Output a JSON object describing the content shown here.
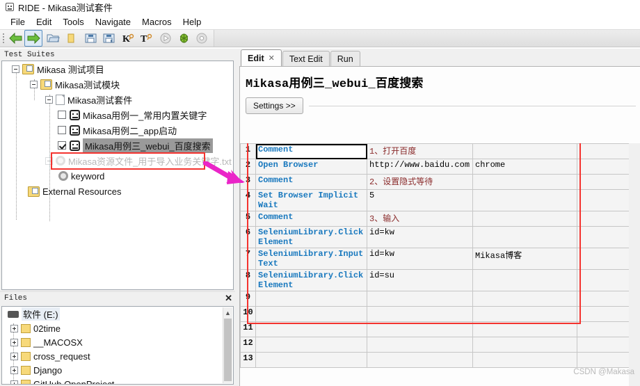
{
  "window": {
    "title": "RIDE - Mikasa测试套件",
    "icon": "app-icon"
  },
  "menubar": {
    "items": [
      "File",
      "Edit",
      "Tools",
      "Navigate",
      "Macros",
      "Help"
    ]
  },
  "toolbar": {
    "buttons": [
      {
        "name": "back-icon",
        "selected": false
      },
      {
        "name": "forward-icon",
        "selected": true
      },
      {
        "name": "open-folder-icon",
        "selected": false
      },
      {
        "name": "new-folder-icon",
        "selected": false
      },
      {
        "name": "save-icon",
        "selected": false
      },
      {
        "name": "save-all-icon",
        "selected": false
      },
      {
        "name": "search-keyword-icon",
        "selected": false
      },
      {
        "name": "search-test-icon",
        "selected": false
      },
      {
        "name": "run-icon",
        "selected": false
      },
      {
        "name": "debug-icon",
        "selected": false
      },
      {
        "name": "stop-icon",
        "selected": false
      }
    ]
  },
  "test_suites_panel": {
    "caption": "Test Suites",
    "tree": [
      {
        "label": "Mikasa 测试项目",
        "indent": 0,
        "icon": "project-icon",
        "expander": "minus",
        "checkbox": null,
        "state": "normal"
      },
      {
        "label": "Mikasa测试模块",
        "indent": 1,
        "icon": "project-icon",
        "expander": "minus",
        "checkbox": null,
        "state": "normal"
      },
      {
        "label": "Mikasa测试套件",
        "indent": 2,
        "icon": "document-icon",
        "expander": "minus",
        "checkbox": null,
        "state": "normal"
      },
      {
        "label": "Mikasa用例一_常用内置关键字",
        "indent": 3,
        "icon": "testcase-icon",
        "expander": null,
        "checkbox": "off",
        "state": "normal"
      },
      {
        "label": "Mikasa用例二_app启动",
        "indent": 3,
        "icon": "testcase-icon",
        "expander": null,
        "checkbox": "off",
        "state": "normal"
      },
      {
        "label": "Mikasa用例三_webui_百度搜索",
        "indent": 3,
        "icon": "testcase-icon",
        "expander": null,
        "checkbox": "on",
        "state": "selected"
      },
      {
        "label": "Mikasa资源文件_用于导入业务关键字.txt",
        "indent": 2,
        "icon": "gear-icon",
        "expander": "minus",
        "checkbox": null,
        "state": "ghost"
      },
      {
        "label": "keyword",
        "indent": 3,
        "icon": "gear-icon",
        "expander": null,
        "checkbox": null,
        "state": "normal"
      },
      {
        "label": "External Resources",
        "indent": 0,
        "icon": "project-icon",
        "expander": null,
        "checkbox": null,
        "state": "normal"
      }
    ]
  },
  "files_panel": {
    "caption": "Files",
    "close_label": "✕",
    "items": [
      {
        "label": "软件 (E:)",
        "icon": "drive-icon",
        "expander": null,
        "selected": true
      },
      {
        "label": "02time",
        "icon": "folder-icon",
        "expander": "plus",
        "selected": false
      },
      {
        "label": "__MACOSX",
        "icon": "folder-icon",
        "expander": "plus",
        "selected": false
      },
      {
        "label": "cross_request",
        "icon": "folder-icon",
        "expander": "plus",
        "selected": false
      },
      {
        "label": "Django",
        "icon": "folder-icon",
        "expander": "plus",
        "selected": false
      },
      {
        "label": "GitHub OpenProject",
        "icon": "folder-icon",
        "expander": "plus",
        "selected": false
      }
    ]
  },
  "editor": {
    "tabs": [
      {
        "label": "Edit",
        "active": true,
        "closable": true,
        "close_label": "✕"
      },
      {
        "label": "Text Edit",
        "active": false,
        "closable": false,
        "close_label": ""
      },
      {
        "label": "Run",
        "active": false,
        "closable": false,
        "close_label": ""
      }
    ],
    "testcase_title": "Mikasa用例三_webui_百度搜索",
    "settings_button": "Settings >>",
    "watermark": "CSDN @Makasa",
    "grid": {
      "rows": [
        {
          "num": "1",
          "cells": [
            {
              "text": "Comment",
              "style": "kw",
              "bg": "white",
              "selected": true
            },
            {
              "text": "1、打开百度",
              "style": "cmt",
              "bg": "gridbg",
              "selected": false
            },
            {
              "text": "",
              "style": "plain",
              "bg": "gridbg",
              "selected": false
            },
            {
              "text": "",
              "style": "plain",
              "bg": "gridbg",
              "selected": false
            }
          ]
        },
        {
          "num": "2",
          "cells": [
            {
              "text": "Open Browser",
              "style": "kw",
              "bg": "white",
              "selected": false
            },
            {
              "text": "http://www.baidu.com",
              "style": "plain",
              "bg": "white",
              "selected": false
            },
            {
              "text": "chrome",
              "style": "plain",
              "bg": "white",
              "selected": false
            },
            {
              "text": "",
              "style": "plain",
              "bg": "gridbg",
              "selected": false
            }
          ]
        },
        {
          "num": "3",
          "cells": [
            {
              "text": "Comment",
              "style": "kw",
              "bg": "white",
              "selected": false
            },
            {
              "text": "2、设置隐式等待",
              "style": "cmt",
              "bg": "gridbg",
              "selected": false
            },
            {
              "text": "",
              "style": "plain",
              "bg": "gridbg",
              "selected": false
            },
            {
              "text": "",
              "style": "plain",
              "bg": "gridbg",
              "selected": false
            }
          ]
        },
        {
          "num": "4",
          "cells": [
            {
              "text": "Set Browser Implicit Wait",
              "style": "kw",
              "bg": "white",
              "selected": false
            },
            {
              "text": "5",
              "style": "plain",
              "bg": "white",
              "selected": false
            },
            {
              "text": "",
              "style": "plain",
              "bg": "gray",
              "selected": false
            },
            {
              "text": "",
              "style": "plain",
              "bg": "gray",
              "selected": false
            }
          ]
        },
        {
          "num": "5",
          "cells": [
            {
              "text": "Comment",
              "style": "kw",
              "bg": "white",
              "selected": false
            },
            {
              "text": "3、输入",
              "style": "cmt",
              "bg": "gridbg",
              "selected": false
            },
            {
              "text": "",
              "style": "plain",
              "bg": "gridbg",
              "selected": false
            },
            {
              "text": "",
              "style": "plain",
              "bg": "gridbg",
              "selected": false
            }
          ]
        },
        {
          "num": "6",
          "cells": [
            {
              "text": "SeleniumLibrary.Click Element",
              "style": "kw",
              "bg": "white",
              "selected": false
            },
            {
              "text": "id=kw",
              "style": "plain",
              "bg": "white",
              "selected": false
            },
            {
              "text": "",
              "style": "plain",
              "bg": "gridbg",
              "selected": false
            },
            {
              "text": "",
              "style": "plain",
              "bg": "gridbg",
              "selected": false
            }
          ]
        },
        {
          "num": "7",
          "cells": [
            {
              "text": "SeleniumLibrary.Input Text",
              "style": "kw",
              "bg": "white",
              "selected": false
            },
            {
              "text": "id=kw",
              "style": "plain",
              "bg": "white",
              "selected": false
            },
            {
              "text": "Mikasa博客",
              "style": "plain",
              "bg": "white",
              "selected": false
            },
            {
              "text": "",
              "style": "plain",
              "bg": "gridbg",
              "selected": false
            }
          ]
        },
        {
          "num": "8",
          "cells": [
            {
              "text": "SeleniumLibrary.Click Element",
              "style": "kw",
              "bg": "white",
              "selected": false
            },
            {
              "text": "id=su",
              "style": "plain",
              "bg": "white",
              "selected": false
            },
            {
              "text": "",
              "style": "plain",
              "bg": "gridbg",
              "selected": false
            },
            {
              "text": "",
              "style": "plain",
              "bg": "gridbg",
              "selected": false
            }
          ]
        },
        {
          "num": "9",
          "cells": [
            {
              "text": "",
              "style": "plain",
              "bg": "white",
              "selected": false
            },
            {
              "text": "",
              "style": "plain",
              "bg": "white",
              "selected": false
            },
            {
              "text": "",
              "style": "plain",
              "bg": "gridbg",
              "selected": false
            },
            {
              "text": "",
              "style": "plain",
              "bg": "gridbg",
              "selected": false
            }
          ]
        },
        {
          "num": "10",
          "cells": [
            {
              "text": "",
              "style": "plain",
              "bg": "white",
              "selected": false
            },
            {
              "text": "",
              "style": "plain",
              "bg": "white",
              "selected": false
            },
            {
              "text": "",
              "style": "plain",
              "bg": "white",
              "selected": false
            },
            {
              "text": "",
              "style": "plain",
              "bg": "white",
              "selected": false
            }
          ]
        },
        {
          "num": "11",
          "cells": [
            {
              "text": "",
              "style": "plain",
              "bg": "white",
              "selected": false
            },
            {
              "text": "",
              "style": "plain",
              "bg": "white",
              "selected": false
            },
            {
              "text": "",
              "style": "plain",
              "bg": "white",
              "selected": false
            },
            {
              "text": "",
              "style": "plain",
              "bg": "white",
              "selected": false
            }
          ]
        },
        {
          "num": "12",
          "cells": [
            {
              "text": "",
              "style": "plain",
              "bg": "white",
              "selected": false
            },
            {
              "text": "",
              "style": "plain",
              "bg": "white",
              "selected": false
            },
            {
              "text": "",
              "style": "plain",
              "bg": "white",
              "selected": false
            },
            {
              "text": "",
              "style": "plain",
              "bg": "white",
              "selected": false
            }
          ]
        },
        {
          "num": "13",
          "cells": [
            {
              "text": "",
              "style": "plain",
              "bg": "white",
              "selected": false
            },
            {
              "text": "",
              "style": "plain",
              "bg": "white",
              "selected": false
            },
            {
              "text": "",
              "style": "plain",
              "bg": "white",
              "selected": false
            },
            {
              "text": "",
              "style": "plain",
              "bg": "white",
              "selected": false
            }
          ]
        }
      ]
    }
  },
  "annotations": {
    "highlight_color": "#f4332f",
    "arrow_color": "#ea25c8"
  }
}
